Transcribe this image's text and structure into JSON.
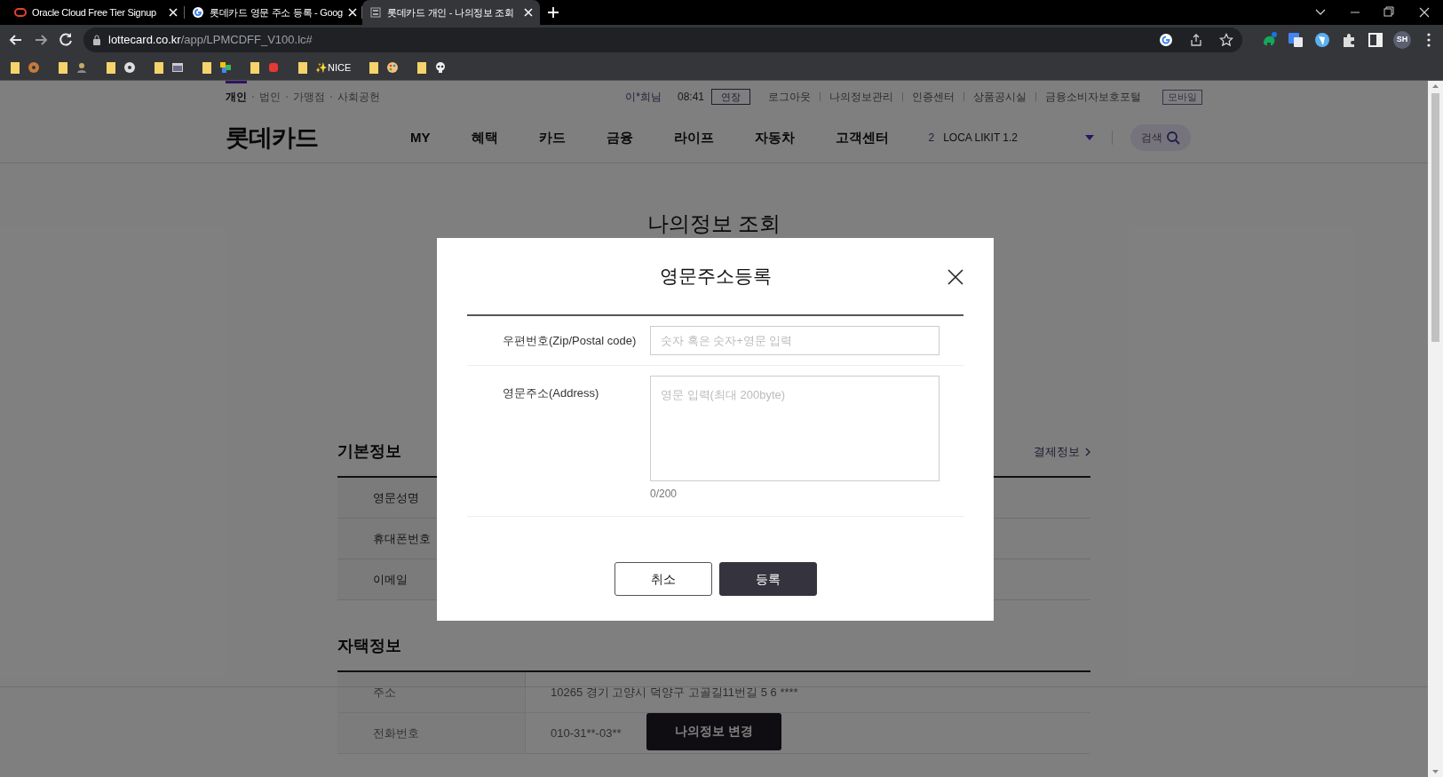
{
  "browser": {
    "tabs": [
      {
        "title": "Oracle Cloud Free Tier Signup",
        "selected": false,
        "kind": "oracle"
      },
      {
        "title": "롯데카드 영문 주소 등록 - Goog",
        "selected": false,
        "kind": "google"
      },
      {
        "title": "롯데카드 개인 - 나의정보 조회",
        "selected": true,
        "kind": "site"
      }
    ],
    "url": {
      "domain": "lottecard.co.kr",
      "path": "/app/LPMCDFF_V100.lc#"
    },
    "bookmark_label": "✨NICE",
    "profile": "SH"
  },
  "site": {
    "segments": [
      {
        "label": "개인",
        "selected": true
      },
      {
        "label": "법인",
        "selected": false
      },
      {
        "label": "가맹점",
        "selected": false
      },
      {
        "label": "사회공헌",
        "selected": false
      }
    ],
    "user": "이*희님",
    "timer": "08:41",
    "extend": "연장",
    "links": [
      "로그아웃",
      "나의정보관리",
      "인증센터",
      "상품공시실",
      "금융소비자보호포털"
    ],
    "mobile": "모바일",
    "logo": "롯데카드",
    "nav": [
      "MY",
      "혜택",
      "카드",
      "금융",
      "라이프",
      "자동차",
      "고객센터"
    ],
    "card": {
      "count": "2",
      "name": "LOCA LIKIT 1.2"
    },
    "search": "검색"
  },
  "page": {
    "title": "나의정보 조회",
    "sections": [
      {
        "title": "기본정보",
        "link": "결제정보",
        "rows": [
          {
            "label": "영문성명"
          },
          {
            "label": "휴대폰번호"
          },
          {
            "label": "이메일"
          }
        ]
      },
      {
        "title": "자택정보",
        "rows": [
          {
            "label": "주소",
            "value": "10265 경기 고양시 덕양구 고골길11번길 5 6 ****"
          },
          {
            "label": "전화번호",
            "value": "010-31**-03**"
          }
        ]
      }
    ],
    "bottom_button": "나의정보 변경"
  },
  "modal": {
    "title": "영문주소등록",
    "fields": [
      {
        "kind": "input",
        "label": "우편번호(Zip/Postal code)",
        "placeholder": "숫자 혹은 숫자+영문 입력"
      },
      {
        "kind": "textarea",
        "label": "영문주소(Address)",
        "placeholder": "영문 입력(최대 200byte)",
        "counter": "0/200"
      }
    ],
    "buttons": [
      {
        "label": "취소",
        "kind": "secondary"
      },
      {
        "label": "등록",
        "kind": "primary"
      }
    ]
  }
}
